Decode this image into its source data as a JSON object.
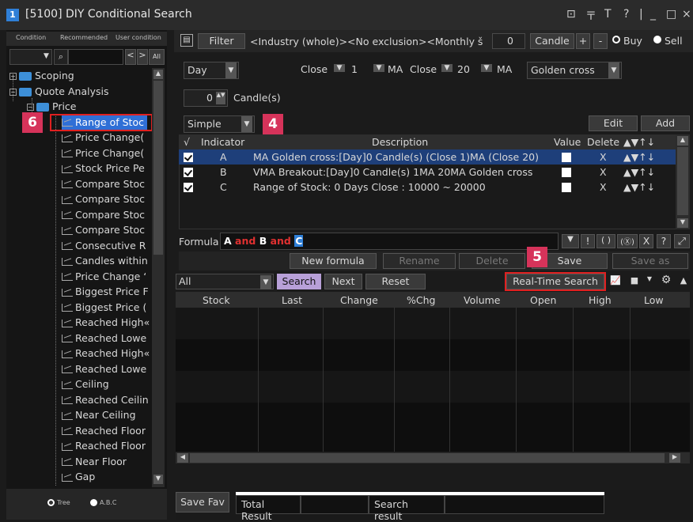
{
  "window": {
    "icon_label": "1",
    "title": "[5100] DIY Conditional Search",
    "controls": [
      "⊡",
      "〒",
      "T",
      "?",
      "|",
      "_",
      "□",
      "×"
    ]
  },
  "left": {
    "tabs": [
      "Condition",
      "Recommended",
      "User condition"
    ],
    "nav": [
      "<",
      ">",
      "All"
    ],
    "tree": [
      {
        "label": "Scoping",
        "type": "folder",
        "level": 0
      },
      {
        "label": "Quote Analysis",
        "type": "folder",
        "level": 0
      },
      {
        "label": "Price",
        "type": "folder",
        "level": 1
      },
      {
        "label": "Range of Stoc",
        "type": "item",
        "selected": true
      },
      {
        "label": "Price Change(",
        "type": "item"
      },
      {
        "label": "Price Change(",
        "type": "item"
      },
      {
        "label": "Stock Price Pe",
        "type": "item"
      },
      {
        "label": "Compare Stoc",
        "type": "item"
      },
      {
        "label": "Compare Stoc",
        "type": "item"
      },
      {
        "label": "Compare Stoc",
        "type": "item"
      },
      {
        "label": "Compare Stoc",
        "type": "item"
      },
      {
        "label": "Consecutive R",
        "type": "item"
      },
      {
        "label": "Candles within",
        "type": "item"
      },
      {
        "label": "Price Change ‘",
        "type": "item"
      },
      {
        "label": "Biggest Price F",
        "type": "item"
      },
      {
        "label": "Biggest Price (",
        "type": "item"
      },
      {
        "label": "Reached High«",
        "type": "item"
      },
      {
        "label": "Reached Lowe",
        "type": "item"
      },
      {
        "label": "Reached High«",
        "type": "item"
      },
      {
        "label": "Reached Lowe",
        "type": "item"
      },
      {
        "label": "Ceiling",
        "type": "item"
      },
      {
        "label": "Reached Ceilin",
        "type": "item"
      },
      {
        "label": "Near Ceiling",
        "type": "item"
      },
      {
        "label": "Reached Floor",
        "type": "item"
      },
      {
        "label": "Reached Floor",
        "type": "item"
      },
      {
        "label": "Near Floor",
        "type": "item"
      },
      {
        "label": "Gap",
        "type": "item"
      }
    ],
    "view_options": [
      {
        "label": "Tree",
        "selected": true
      },
      {
        "label": "A.B.C",
        "selected": false
      }
    ],
    "badge": "6"
  },
  "filter": {
    "button": "Filter",
    "text": "<Industry (whole)><No exclusion><Monthly š",
    "count": "0",
    "candle": "Candle",
    "plus": "+",
    "minus": "-",
    "buy": "Buy",
    "sell": "Sell"
  },
  "condition": {
    "period": "Day",
    "close1": "Close",
    "ma1": "1",
    "ma_label1": "MA",
    "close2": "Close",
    "ma2": "20",
    "ma_label2": "MA",
    "cross": "Golden cross",
    "candles_value": "0",
    "candles_label": "Candle(s)",
    "mode": "Simple",
    "badge": "4",
    "edit": "Edit",
    "add": "Add"
  },
  "table": {
    "headers": {
      "check": "√",
      "indicator": "Indicator",
      "description": "Description",
      "value": "Value",
      "delete": "Delete",
      "order": "▲▼↑↓"
    },
    "rows": [
      {
        "indicator": "A",
        "description": "MA Golden cross:[Day]0 Candle(s) (Close 1)MA (Close 20)",
        "delete": "X",
        "order": "▲▼↑↓"
      },
      {
        "indicator": "B",
        "description": "VMA Breakout:[Day]0 Candle(s) 1MA 20MA Golden cross",
        "delete": "X",
        "order": "▲▼↑↓"
      },
      {
        "indicator": "C",
        "description": "Range of Stock: 0 Days Close : 10000 ~ 20000",
        "delete": "X",
        "order": "▲▼↑↓"
      }
    ]
  },
  "formula": {
    "label": "Formula",
    "a": "A",
    "and1": "and",
    "b": "B",
    "and2": "and",
    "c": "C",
    "tools": [
      "▼",
      "!",
      "( )",
      "(Ⓧ)",
      "X",
      "?",
      "⤢"
    ]
  },
  "actions": {
    "new_formula": "New formula",
    "rename": "Rename",
    "delete": "Delete",
    "save": "Save",
    "save_as": "Save as",
    "badge": "5"
  },
  "search": {
    "scope": "All",
    "search": "Search",
    "next": "Next",
    "reset": "Reset",
    "realtime": "Real-Time Search"
  },
  "results": {
    "columns": [
      "Stock",
      "Last",
      "Change",
      "%Chg",
      "Volume",
      "Open",
      "High",
      "Low"
    ]
  },
  "bottom": {
    "save_fav": "Save Fav",
    "total": "Total Result",
    "search_result": "Search result"
  }
}
